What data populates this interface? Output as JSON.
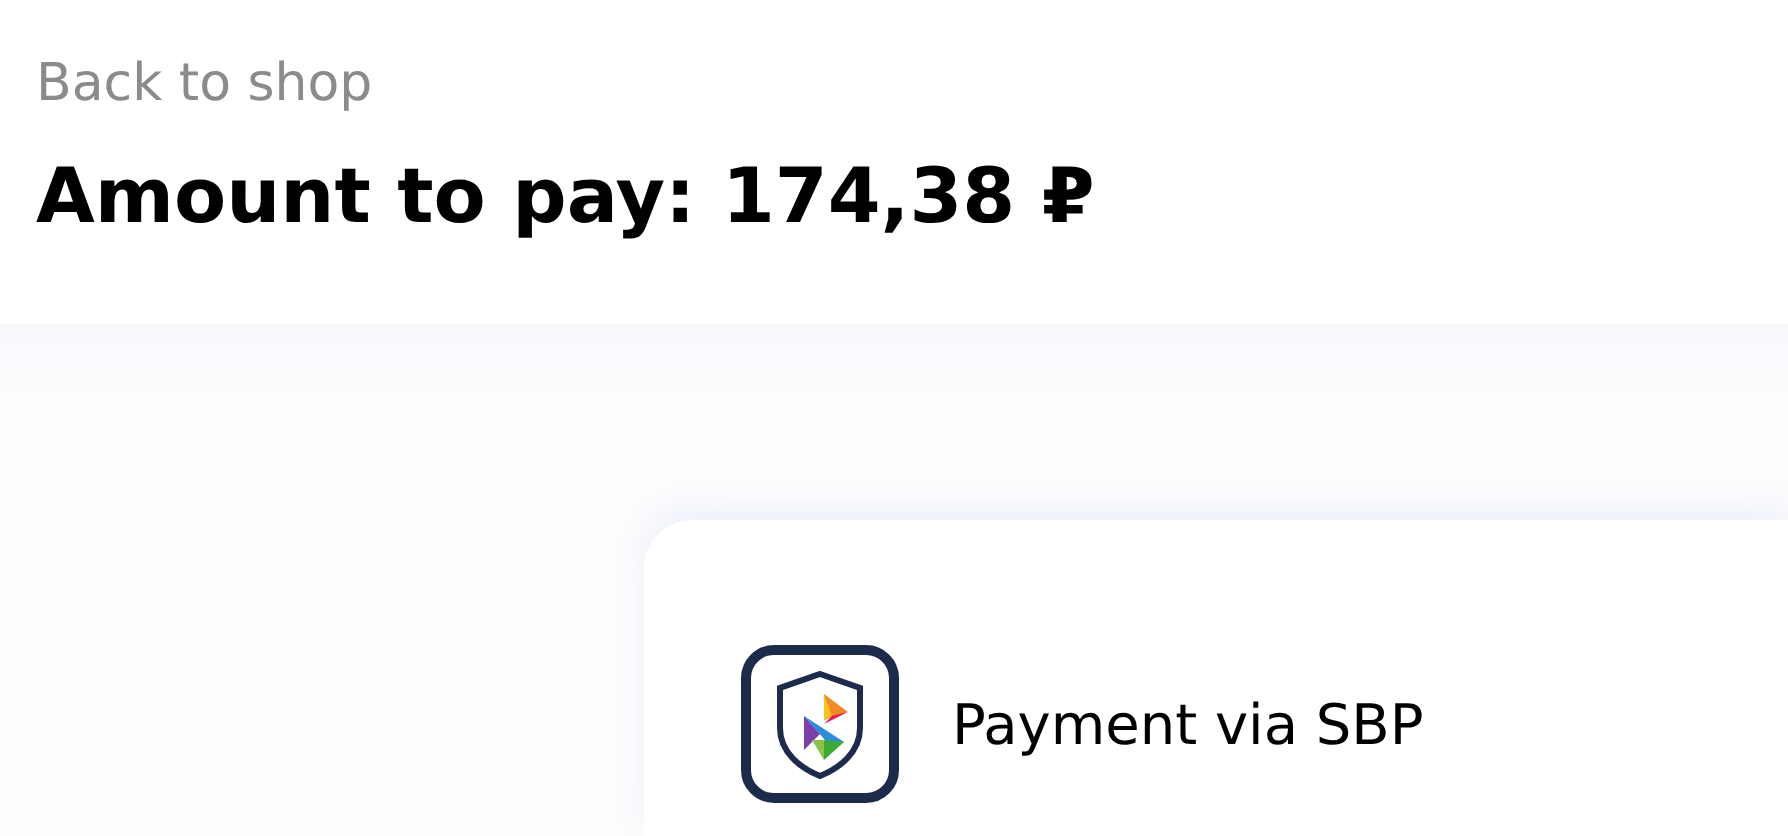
{
  "header": {
    "back_link": "Back to shop",
    "amount_title": "Amount to pay: 174,38 ₽"
  },
  "payment_method": {
    "label": "Payment via SBP"
  }
}
